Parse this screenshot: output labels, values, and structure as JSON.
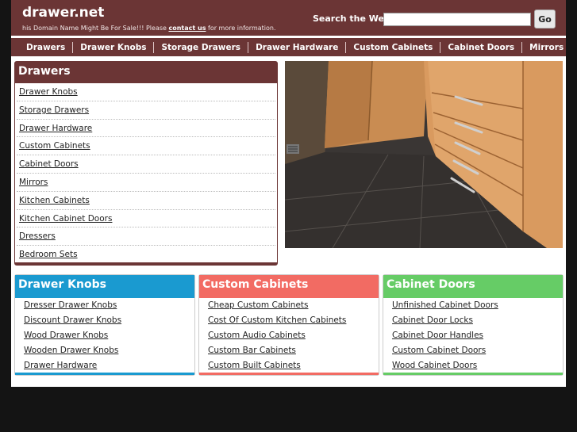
{
  "header": {
    "site_title": "drawer.net",
    "tagline_pre": "his Domain Name Might Be For Sale!!! Please ",
    "tagline_link": "contact us",
    "tagline_post": " for more information.",
    "search_label": "Search the Web:",
    "search_value": "",
    "go_label": "Go"
  },
  "nav": {
    "items": [
      "Drawers",
      "Drawer Knobs",
      "Storage Drawers",
      "Drawer Hardware",
      "Custom Cabinets",
      "Cabinet Doors",
      "Mirrors"
    ]
  },
  "drawers_box": {
    "title": "Drawers",
    "items": [
      "Drawer Knobs",
      "Storage Drawers",
      "Drawer Hardware",
      "Custom Cabinets",
      "Cabinet Doors",
      "Mirrors",
      "Kitchen Cabinets",
      "Kitchen Cabinet Doors",
      "Dressers",
      "Bedroom Sets"
    ]
  },
  "boxes": [
    {
      "title": "Drawer Knobs",
      "color": "#1a9ad0",
      "items": [
        "Dresser Drawer Knobs",
        "Discount Drawer Knobs",
        "Wood Drawer Knobs",
        "Wooden Drawer Knobs",
        "Drawer Hardware"
      ]
    },
    {
      "title": "Custom Cabinets",
      "color": "#f26b63",
      "items": [
        "Cheap Custom Cabinets",
        "Cost Of Custom Kitchen Cabinets",
        "Custom Audio Cabinets",
        "Custom Bar Cabinets",
        "Custom Built Cabinets"
      ]
    },
    {
      "title": "Cabinet Doors",
      "color": "#66cc66",
      "items": [
        "Unfinished Cabinet Doors",
        "Cabinet Door Locks",
        "Cabinet Door Handles",
        "Custom Cabinet Doors",
        "Wood Cabinet Doors"
      ]
    }
  ],
  "colors": {
    "brand": "#6b3535",
    "background": "#141414"
  }
}
